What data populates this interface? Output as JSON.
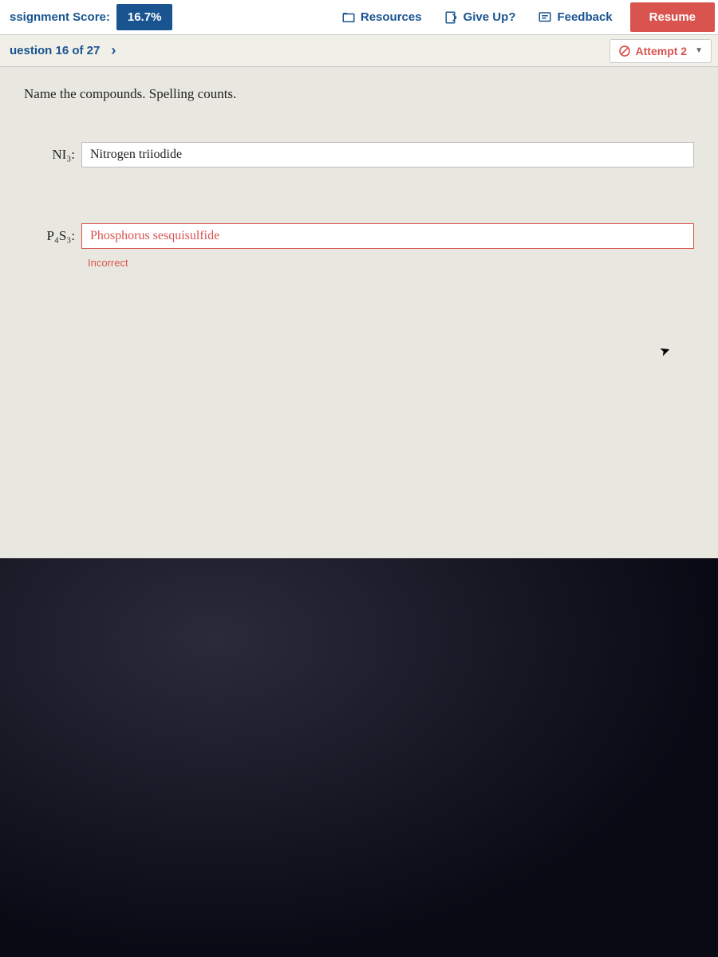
{
  "topbar": {
    "score_label": "ssignment Score:",
    "score_value": "16.7%",
    "resources_label": "Resources",
    "giveup_label": "Give Up?",
    "feedback_label": "Feedback",
    "resume_label": "Resume"
  },
  "question_bar": {
    "label": "uestion 16 of 27",
    "attempt_label": "Attempt 2"
  },
  "content": {
    "prompt": "Name the compounds. Spelling counts.",
    "compound1": {
      "formula_html": "NI₃:",
      "value": "Nitrogen triiodide"
    },
    "compound2": {
      "formula_html": "P₄S₃:",
      "value": "Phosphorus sesquisulfide",
      "error": "Incorrect"
    }
  }
}
